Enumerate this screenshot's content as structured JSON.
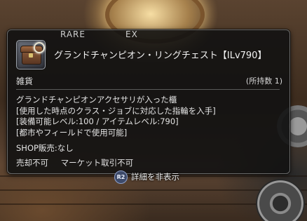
{
  "tooltip": {
    "rarity_labels": [
      "RARE",
      "EX"
    ],
    "item_icon": "treasure-chest-icon",
    "item_name": "グランドチャンピオン・リングチェスト【ILv790】",
    "category": "雑貨",
    "owned_count": "(所持数 1)",
    "description_lines": [
      "グランドチャンピオンアクセサリが入った櫃",
      "[使用した時点のクラス・ジョブに対応した指輪を入手]",
      "[装備可能レベル:100 / アイテムレベル:790]",
      "[都市やフィールドで使用可能]"
    ],
    "shop_sale": "SHOP販売:なし",
    "restrictions": [
      "売却不可",
      "マーケット取引不可"
    ]
  },
  "hint": {
    "button_glyph": "R2",
    "label": "詳細を非表示"
  }
}
